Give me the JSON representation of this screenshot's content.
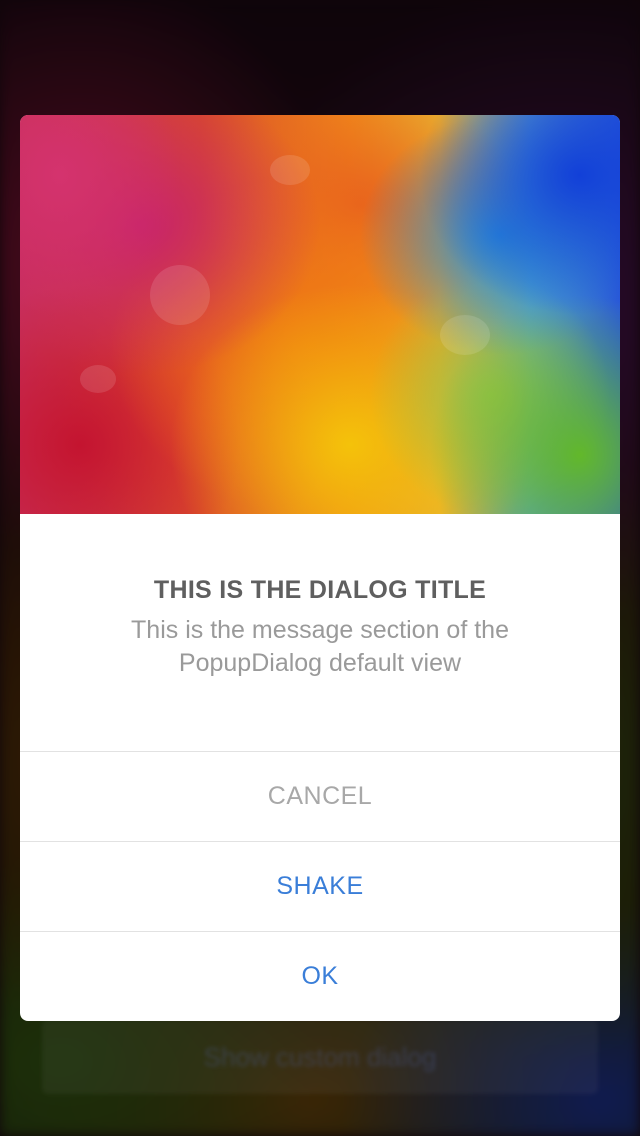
{
  "background": {
    "ghost_button_label": "Show custom dialog"
  },
  "dialog": {
    "title": "THIS IS THE DIALOG TITLE",
    "message": "This is the message section of the PopupDialog default view",
    "buttons": {
      "cancel": "CANCEL",
      "shake": "SHAKE",
      "ok": "OK"
    }
  },
  "colors": {
    "title": "#5f5f5f",
    "message": "#9a9a9a",
    "cancel": "#a8a8a8",
    "action": "#3a7ed8",
    "separator": "#e2e2e2"
  }
}
